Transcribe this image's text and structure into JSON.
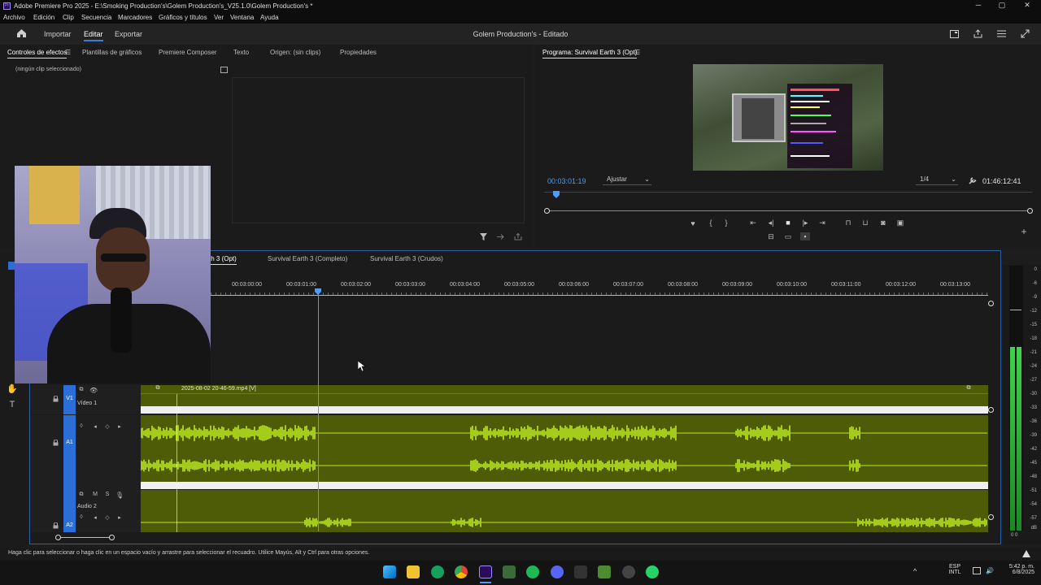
{
  "window": {
    "title": "Adobe Premiere Pro 2025 - E:\\Smoking Production's\\Golem Production's_V25.1.0\\Golem Production's *",
    "logo": "Pr",
    "minimize_icon": "─",
    "maximize_icon": "▢",
    "close_icon": "✕"
  },
  "menu": [
    "Archivo",
    "Edición",
    "Clip",
    "Secuencia",
    "Marcadores",
    "Gráficos y títulos",
    "Ver",
    "Ventana",
    "Ayuda"
  ],
  "workspace": {
    "tabs": [
      "Importar",
      "Editar",
      "Exportar"
    ],
    "active_tab": "Editar",
    "project_title": "Golem Production's - Editado"
  },
  "source_panel": {
    "tabs": [
      "Controles de efectos",
      "Plantillas de gráficos",
      "Premiere Composer",
      "Texto",
      "Origen: (sin clips)",
      "Propiedades"
    ],
    "active_tab": "Controles de efectos",
    "no_clip": "(ningún clip seleccionado)"
  },
  "program": {
    "title": "Programa: Survival Earth 3 (Opt)",
    "timecode": "00:03:01:19",
    "fit": "Ajustar",
    "resolution": "1/4",
    "duration": "01:46:12:41",
    "progress": 0.02
  },
  "timeline": {
    "tabs": [
      "Survival Earth 3 (Opt)",
      "Survival Earth 3 (Completo)",
      "Survival Earth 3 (Crudos)"
    ],
    "active_tab": "Survival Earth 3 (Opt)",
    "active_tab_visible": "th 3 (Opt)",
    "ruler": [
      "00:03:00:00",
      "00:03:01:00",
      "00:03:02:00",
      "00:03:03:00",
      "00:03:04:00",
      "00:03:05:00",
      "00:03:06:00",
      "00:03:07:00",
      "00:03:08:00",
      "00:03:09:00",
      "00:03:10:00",
      "00:03:11:00",
      "00:03:12:00",
      "00:03:13:00"
    ],
    "tracks": {
      "v1": {
        "id": "V1",
        "name": "Vídeo 1"
      },
      "a1": {
        "id": "A1"
      },
      "a2": {
        "id": "A2",
        "name": "Audio 2"
      }
    },
    "clip_name": "2025-08-02 20-46-59.mp4 [V]"
  },
  "meter": {
    "scale": [
      "0",
      "-6",
      "-9",
      "-12",
      "-15",
      "-18",
      "-21",
      "-24",
      "-27",
      "-30",
      "-33",
      "-36",
      "-39",
      "-42",
      "-45",
      "-48",
      "-51",
      "-54",
      "-57",
      "dB"
    ],
    "footer": "0 0"
  },
  "status": "Haga clic para seleccionar o haga clic en un espacio vacío y arrastre para seleccionar el recuadro. Utilice Mayús, Alt y Ctrl para otras opciones.",
  "taskbar": {
    "lang": "ESP",
    "layout": "INTL",
    "time": "5:42 p. m.",
    "date": "6/8/2025"
  },
  "colors": {
    "accent": "#3b7be0",
    "audio": "#4e5c07",
    "waveform": "#a6cc1b",
    "track_label": "#2b6fd6"
  }
}
